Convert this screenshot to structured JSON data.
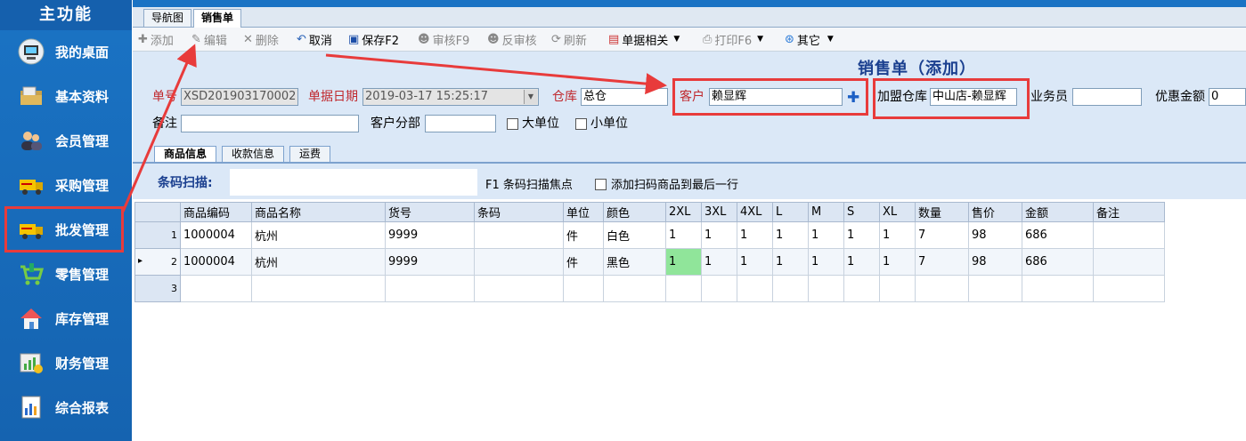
{
  "sidebar": {
    "title": "主功能",
    "items": [
      {
        "label": "我的桌面",
        "icon": "desktop-icon"
      },
      {
        "label": "基本资料",
        "icon": "folder-icon"
      },
      {
        "label": "会员管理",
        "icon": "member-icon"
      },
      {
        "label": "采购管理",
        "icon": "truck-icon"
      },
      {
        "label": "批发管理",
        "icon": "truck-icon"
      },
      {
        "label": "零售管理",
        "icon": "cart-icon"
      },
      {
        "label": "库存管理",
        "icon": "house-icon"
      },
      {
        "label": "财务管理",
        "icon": "finance-icon"
      },
      {
        "label": "综合报表",
        "icon": "report-icon"
      }
    ]
  },
  "tabs": [
    {
      "label": "导航图"
    },
    {
      "label": "销售单"
    }
  ],
  "toolbar": {
    "add": "添加",
    "edit": "编辑",
    "delete": "删除",
    "cancel": "取消",
    "save": "保存F2",
    "approve": "审核F9",
    "unapprove": "反审核",
    "refresh": "刷新",
    "doc_related": "单据相关",
    "print": "打印F6",
    "other": "其它"
  },
  "form": {
    "title": "销售单（添加）",
    "doc_no_label": "单号",
    "doc_no": "XSD201903170002",
    "date_label": "单据日期",
    "date": "2019-03-17 15:25:17",
    "warehouse_label": "仓库",
    "warehouse": "总仓",
    "customer_label": "客户",
    "customer": "赖显辉",
    "franchise_label": "加盟仓库",
    "franchise": "中山店-赖显辉",
    "salesman_label": "业务员",
    "salesman": "",
    "discount_label": "优惠金额",
    "discount": "0",
    "remark_label": "备注",
    "remark": "",
    "branch_label": "客户分部",
    "branch": "",
    "big_unit_label": "大单位",
    "small_unit_label": "小单位"
  },
  "subtabs": [
    {
      "label": "商品信息"
    },
    {
      "label": "收款信息"
    },
    {
      "label": "运费"
    }
  ],
  "scan": {
    "label": "条码扫描:",
    "value": "",
    "hint": "F1 条码扫描焦点",
    "append_label": "添加扫码商品到最后一行"
  },
  "grid": {
    "columns": [
      "",
      "商品编码",
      "商品名称",
      "货号",
      "条码",
      "单位",
      "颜色",
      "2XL",
      "3XL",
      "4XL",
      "L",
      "M",
      "S",
      "XL",
      "数量",
      "售价",
      "金额",
      "备注"
    ],
    "rows": [
      {
        "marker": "",
        "num": "1",
        "cells": [
          "1000004",
          "杭州",
          "9999",
          "",
          "件",
          "白色",
          "1",
          "1",
          "1",
          "1",
          "1",
          "1",
          "1",
          "7",
          "98",
          "686",
          ""
        ]
      },
      {
        "marker": "▸",
        "num": "2",
        "cells": [
          "1000004",
          "杭州",
          "9999",
          "",
          "件",
          "黑色",
          "1",
          "1",
          "1",
          "1",
          "1",
          "1",
          "1",
          "7",
          "98",
          "686",
          ""
        ]
      },
      {
        "marker": "",
        "num": "3",
        "cells": [
          "",
          "",
          "",
          "",
          "",
          "",
          "",
          "",
          "",
          "",
          "",
          "",
          "",
          "",
          "",
          "",
          ""
        ]
      }
    ]
  },
  "colors": {
    "sidebar": "#1a73c4",
    "highlight": "#e83b3b",
    "active_cell": "#90e59a",
    "form_bg": "#dbe8f7"
  }
}
